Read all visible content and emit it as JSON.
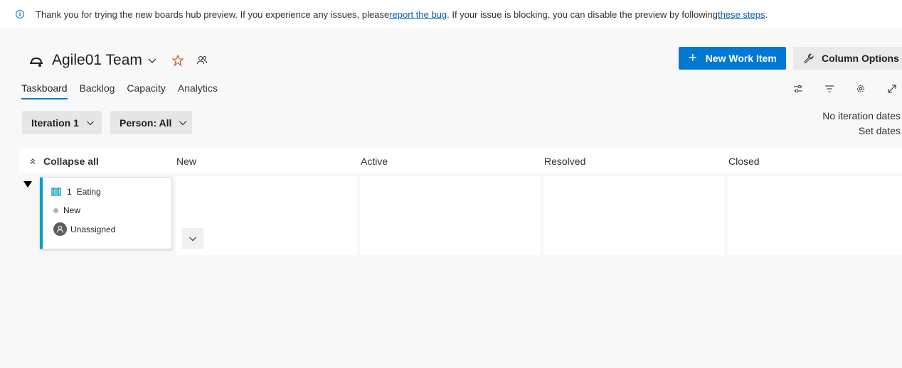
{
  "banner": {
    "text_before": "Thank you for trying the new boards hub preview. If you experience any issues, please ",
    "link1": "report the bug",
    "text_middle": ". If your issue is blocking, you can disable the preview by following ",
    "link2": "these steps",
    "text_after": ".",
    "icon": "info-icon"
  },
  "header": {
    "team_name": "Agile01 Team",
    "team_icon": "team-icon",
    "favorite_icon": "star-icon",
    "members_icon": "people-icon"
  },
  "actions": {
    "new_work_item": "New Work Item",
    "column_options": "Column Options"
  },
  "tabs": [
    {
      "label": "Taskboard",
      "active": true
    },
    {
      "label": "Backlog",
      "active": false
    },
    {
      "label": "Capacity",
      "active": false
    },
    {
      "label": "Analytics",
      "active": false
    }
  ],
  "toolbar": {
    "icons": [
      "settings-sliders-icon",
      "filter-icon",
      "gear-icon",
      "fullscreen-icon"
    ]
  },
  "filters": {
    "iteration": "Iteration 1",
    "person": "Person: All"
  },
  "iteration_info": {
    "dates": "No iteration dates",
    "set_dates": "Set dates"
  },
  "board": {
    "collapse_all": "Collapse all",
    "columns": [
      "New",
      "Active",
      "Resolved",
      "Closed"
    ],
    "card": {
      "id": "1",
      "title": "Eating",
      "state": "New",
      "assignee": "Unassigned",
      "type_icon": "book-icon",
      "accent_color": "#009ccc"
    }
  },
  "colors": {
    "primary": "#0078d4",
    "link": "#0060b0"
  }
}
